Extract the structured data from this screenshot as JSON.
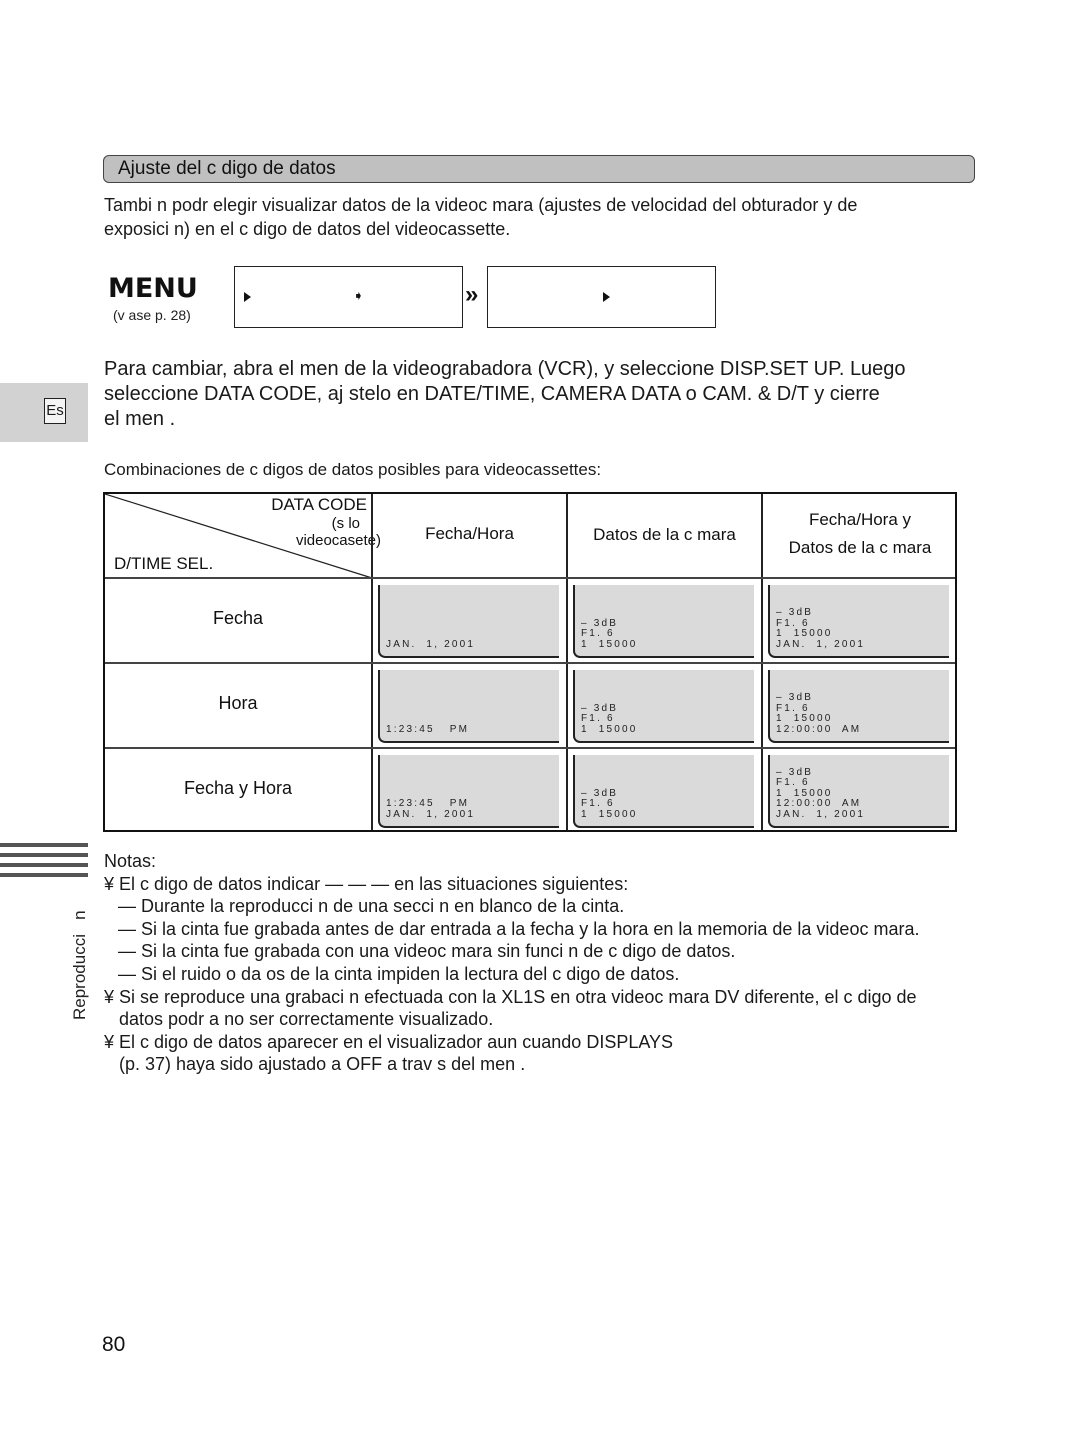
{
  "section": {
    "title": "Ajuste del c   digo de datos"
  },
  "intro": {
    "line1": "Tambi n podr  elegir visualizar datos de la videoc mara (ajustes de velocidad del obturador y de",
    "line2": "exposici n) en el c digo de datos del videocassette."
  },
  "menu": {
    "logo": "MENU",
    "ref": "(v ase p. 28)",
    "arrow_icon": "➧",
    "double_chevron": "»"
  },
  "lang_tab": "Es",
  "instructions": {
    "line1": "Para cambiar, abra el men  de la videograbadora (VCR), y seleccione DISP.SET UP.  Luego",
    "line2": "seleccione DATA CODE, aj stelo en DATE/TIME, CAMERA DATA o CAM. & D/T y cierre",
    "line3": "el men ."
  },
  "combos_caption": "Combinaciones de c digos de datos posibles para videocassettes:",
  "table": {
    "corner": {
      "top": "DATA CODE",
      "sub1": "(s lo",
      "sub2": "videocasete)",
      "bottom": "D/TIME SEL."
    },
    "columns": [
      "Fecha/Hora",
      "Datos de la c mara",
      "Fecha/Hora y",
      "Datos de la c mara"
    ],
    "rows": [
      {
        "label": "Fecha",
        "cells": [
          "JAN.  1, 2001",
          "– 3dB\nF1. 6\n1  15000",
          "– 3dB\nF1. 6\n1  15000\nJAN.  1, 2001"
        ]
      },
      {
        "label": "Hora",
        "cells": [
          "1:23:45   PM",
          "– 3dB\nF1. 6\n1  15000",
          "– 3dB\nF1. 6\n1  15000\n12:00:00  AM"
        ]
      },
      {
        "label": "Fecha y Hora",
        "cells": [
          "1:23:45   PM\nJAN.  1, 2001",
          "– 3dB\nF1. 6\n1  15000",
          "– 3dB\nF1. 6\n1  15000\n12:00:00  AM\nJAN.  1, 2001"
        ]
      }
    ]
  },
  "side_label": "Reproducci   n",
  "notes": {
    "title": "Notas:",
    "items": [
      "¥ El c digo de datos indicar   — — —   en las situaciones siguientes:",
      "— Durante la reproducci n de una secci n en blanco de la cinta.",
      "— Si la cinta fue grabada antes de dar entrada a la fecha y la hora en la memoria de la videoc mara.",
      "— Si la cinta fue grabada con una videoc mara sin funci n de c digo de datos.",
      "— Si el ruido o da os de la cinta impiden la lectura del c digo de datos.",
      "¥ Si se reproduce una grabaci n efectuada con la XL1S en otra videoc mara DV diferente, el c digo de",
      "datos podr a no ser correctamente visualizado.",
      "¥ El c digo de datos aparecer  en el visualizador aun cuando DISPLAYS",
      "(p. 37) haya sido ajustado a OFF a trav s del men ."
    ]
  },
  "page_number": "80"
}
